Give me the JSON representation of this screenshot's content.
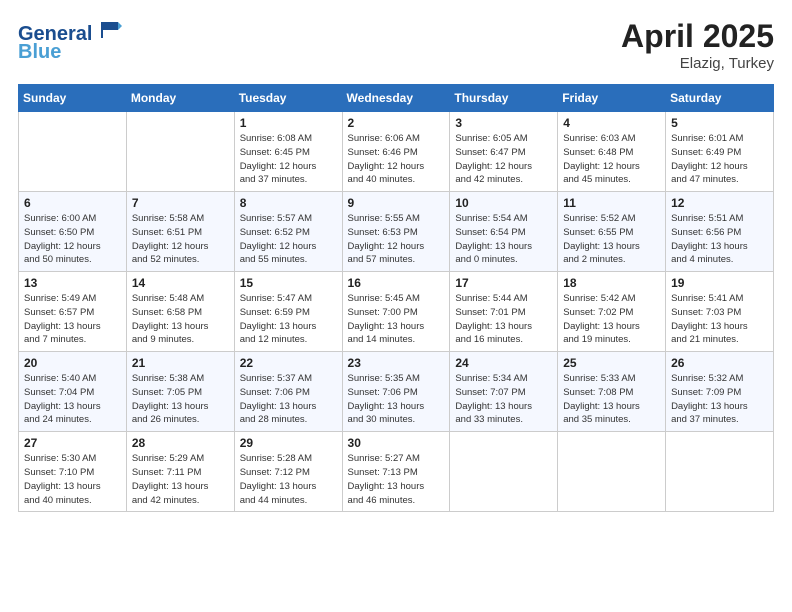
{
  "header": {
    "logo_line1": "General",
    "logo_line2": "Blue",
    "month": "April 2025",
    "location": "Elazig, Turkey"
  },
  "weekdays": [
    "Sunday",
    "Monday",
    "Tuesday",
    "Wednesday",
    "Thursday",
    "Friday",
    "Saturday"
  ],
  "weeks": [
    [
      {
        "day": "",
        "info": ""
      },
      {
        "day": "",
        "info": ""
      },
      {
        "day": "1",
        "info": "Sunrise: 6:08 AM\nSunset: 6:45 PM\nDaylight: 12 hours\nand 37 minutes."
      },
      {
        "day": "2",
        "info": "Sunrise: 6:06 AM\nSunset: 6:46 PM\nDaylight: 12 hours\nand 40 minutes."
      },
      {
        "day": "3",
        "info": "Sunrise: 6:05 AM\nSunset: 6:47 PM\nDaylight: 12 hours\nand 42 minutes."
      },
      {
        "day": "4",
        "info": "Sunrise: 6:03 AM\nSunset: 6:48 PM\nDaylight: 12 hours\nand 45 minutes."
      },
      {
        "day": "5",
        "info": "Sunrise: 6:01 AM\nSunset: 6:49 PM\nDaylight: 12 hours\nand 47 minutes."
      }
    ],
    [
      {
        "day": "6",
        "info": "Sunrise: 6:00 AM\nSunset: 6:50 PM\nDaylight: 12 hours\nand 50 minutes."
      },
      {
        "day": "7",
        "info": "Sunrise: 5:58 AM\nSunset: 6:51 PM\nDaylight: 12 hours\nand 52 minutes."
      },
      {
        "day": "8",
        "info": "Sunrise: 5:57 AM\nSunset: 6:52 PM\nDaylight: 12 hours\nand 55 minutes."
      },
      {
        "day": "9",
        "info": "Sunrise: 5:55 AM\nSunset: 6:53 PM\nDaylight: 12 hours\nand 57 minutes."
      },
      {
        "day": "10",
        "info": "Sunrise: 5:54 AM\nSunset: 6:54 PM\nDaylight: 13 hours\nand 0 minutes."
      },
      {
        "day": "11",
        "info": "Sunrise: 5:52 AM\nSunset: 6:55 PM\nDaylight: 13 hours\nand 2 minutes."
      },
      {
        "day": "12",
        "info": "Sunrise: 5:51 AM\nSunset: 6:56 PM\nDaylight: 13 hours\nand 4 minutes."
      }
    ],
    [
      {
        "day": "13",
        "info": "Sunrise: 5:49 AM\nSunset: 6:57 PM\nDaylight: 13 hours\nand 7 minutes."
      },
      {
        "day": "14",
        "info": "Sunrise: 5:48 AM\nSunset: 6:58 PM\nDaylight: 13 hours\nand 9 minutes."
      },
      {
        "day": "15",
        "info": "Sunrise: 5:47 AM\nSunset: 6:59 PM\nDaylight: 13 hours\nand 12 minutes."
      },
      {
        "day": "16",
        "info": "Sunrise: 5:45 AM\nSunset: 7:00 PM\nDaylight: 13 hours\nand 14 minutes."
      },
      {
        "day": "17",
        "info": "Sunrise: 5:44 AM\nSunset: 7:01 PM\nDaylight: 13 hours\nand 16 minutes."
      },
      {
        "day": "18",
        "info": "Sunrise: 5:42 AM\nSunset: 7:02 PM\nDaylight: 13 hours\nand 19 minutes."
      },
      {
        "day": "19",
        "info": "Sunrise: 5:41 AM\nSunset: 7:03 PM\nDaylight: 13 hours\nand 21 minutes."
      }
    ],
    [
      {
        "day": "20",
        "info": "Sunrise: 5:40 AM\nSunset: 7:04 PM\nDaylight: 13 hours\nand 24 minutes."
      },
      {
        "day": "21",
        "info": "Sunrise: 5:38 AM\nSunset: 7:05 PM\nDaylight: 13 hours\nand 26 minutes."
      },
      {
        "day": "22",
        "info": "Sunrise: 5:37 AM\nSunset: 7:06 PM\nDaylight: 13 hours\nand 28 minutes."
      },
      {
        "day": "23",
        "info": "Sunrise: 5:35 AM\nSunset: 7:06 PM\nDaylight: 13 hours\nand 30 minutes."
      },
      {
        "day": "24",
        "info": "Sunrise: 5:34 AM\nSunset: 7:07 PM\nDaylight: 13 hours\nand 33 minutes."
      },
      {
        "day": "25",
        "info": "Sunrise: 5:33 AM\nSunset: 7:08 PM\nDaylight: 13 hours\nand 35 minutes."
      },
      {
        "day": "26",
        "info": "Sunrise: 5:32 AM\nSunset: 7:09 PM\nDaylight: 13 hours\nand 37 minutes."
      }
    ],
    [
      {
        "day": "27",
        "info": "Sunrise: 5:30 AM\nSunset: 7:10 PM\nDaylight: 13 hours\nand 40 minutes."
      },
      {
        "day": "28",
        "info": "Sunrise: 5:29 AM\nSunset: 7:11 PM\nDaylight: 13 hours\nand 42 minutes."
      },
      {
        "day": "29",
        "info": "Sunrise: 5:28 AM\nSunset: 7:12 PM\nDaylight: 13 hours\nand 44 minutes."
      },
      {
        "day": "30",
        "info": "Sunrise: 5:27 AM\nSunset: 7:13 PM\nDaylight: 13 hours\nand 46 minutes."
      },
      {
        "day": "",
        "info": ""
      },
      {
        "day": "",
        "info": ""
      },
      {
        "day": "",
        "info": ""
      }
    ]
  ]
}
